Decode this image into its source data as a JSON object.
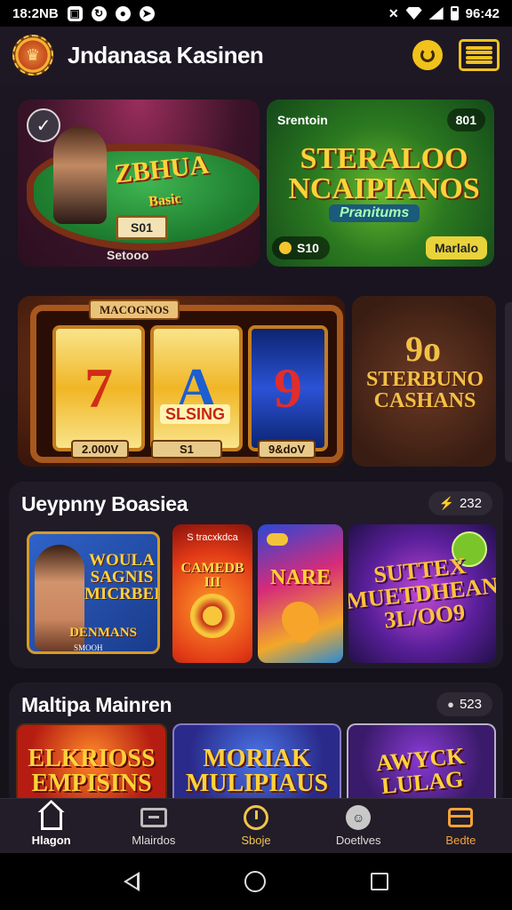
{
  "status_bar": {
    "time": "18:2NB",
    "right_text": "96:42"
  },
  "app": {
    "title": "Jndanasa Kasinen"
  },
  "featured": {
    "poker": {
      "logo": "ZBHUA",
      "logo_sub": "Basic",
      "plaque": "S01",
      "caption": "Setooo"
    },
    "green": {
      "top_label": "Srentoin",
      "badge": "801",
      "title": "STERALOO NCAIPIANOS",
      "subtitle": "Pranitums",
      "chip": "S10",
      "play": "Marlalo"
    },
    "slots": {
      "top_label": "MACOGNOS",
      "reel1": "7",
      "reel2": "A",
      "reel3": "9",
      "center": "SLSING",
      "plaque1": "2.000V",
      "plaque2": "S1",
      "plaque3": "9&doV"
    },
    "brown": {
      "number": "9o",
      "title": "STERBUNO CASHANS"
    }
  },
  "section1": {
    "title": "Ueypnny Boasiea",
    "count": "232",
    "cards": [
      {
        "title": "WOULA SAGNIS MICRBEII",
        "sub": "DENMANS",
        "tiny": "SMOOH"
      },
      {
        "top": "S tracxkdca",
        "title": "CAMEDB III"
      },
      {
        "title": "NARE"
      },
      {
        "title": "SUTTEX MUETDHEAN 3L/OO9"
      }
    ]
  },
  "section2": {
    "title": "Maltipa Mainren",
    "count": "523",
    "cards": [
      {
        "title": "ELKRIOSS EMPISINS"
      },
      {
        "title": "MORIAK MULIPIAUS"
      },
      {
        "title": "AWYCK LULAG"
      }
    ]
  },
  "bottom_nav": [
    {
      "label": "Hlagon",
      "icon": "home-icon"
    },
    {
      "label": "Mlairdos",
      "icon": "games-icon"
    },
    {
      "label": "Sboje",
      "icon": "spin-icon"
    },
    {
      "label": "Doetlves",
      "icon": "chat-icon"
    },
    {
      "label": "Bedte",
      "icon": "wallet-icon"
    }
  ],
  "colors": {
    "accent": "#f1c21b",
    "background": "#17121c",
    "nav_active_gold": "#f2c44a",
    "nav_orange": "#f4a23a"
  }
}
